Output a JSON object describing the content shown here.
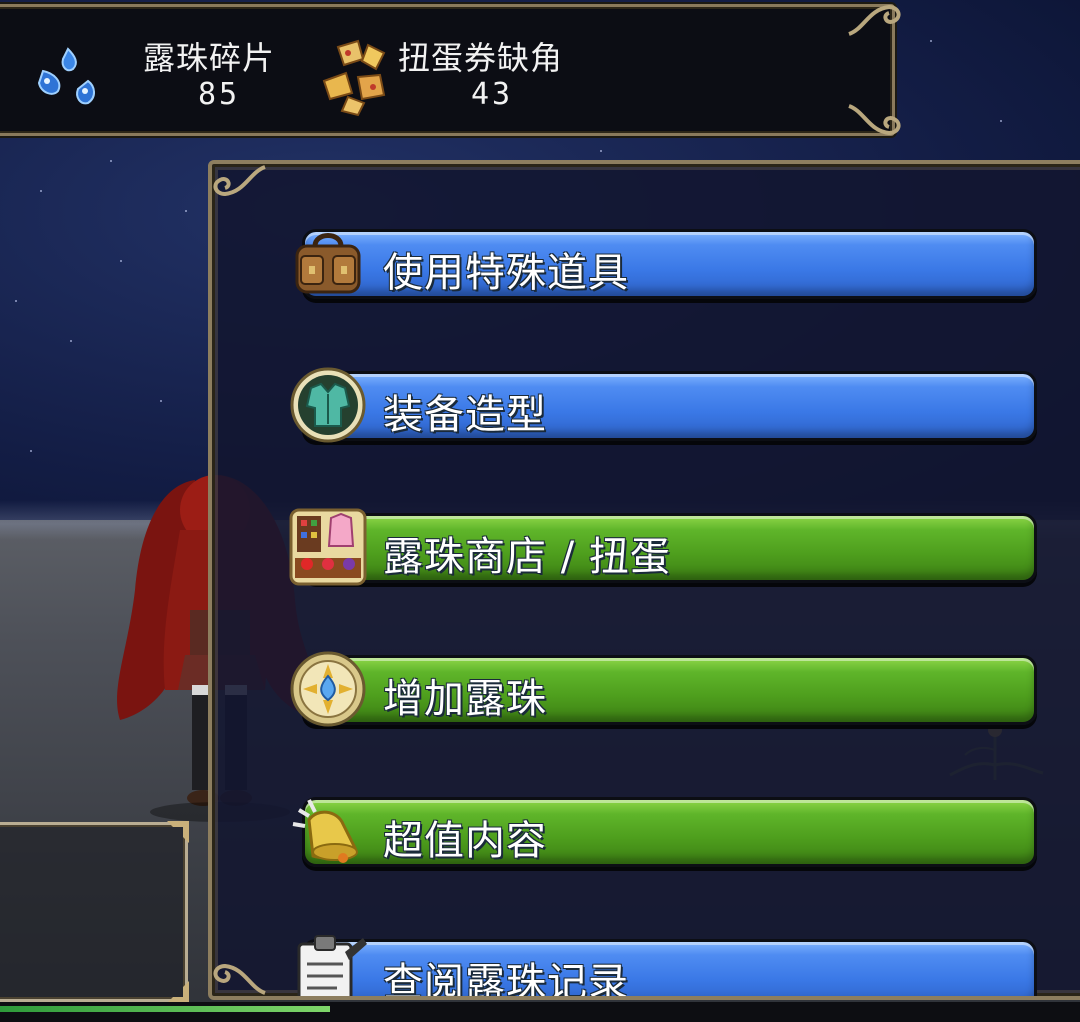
{
  "currencies": [
    {
      "name": "露珠碎片",
      "value": "85",
      "icon": "dew-shard-icon"
    },
    {
      "name": "扭蛋券缺角",
      "value": "43",
      "icon": "gacha-ticket-fragment-icon"
    }
  ],
  "menu": {
    "items": [
      {
        "label": "使用特殊道具",
        "color": "blue",
        "icon": "bag-icon"
      },
      {
        "label": "装备造型",
        "color": "blue",
        "icon": "armor-icon"
      },
      {
        "label": "露珠商店 / 扭蛋",
        "color": "green",
        "icon": "shop-icon"
      },
      {
        "label": "增加露珠",
        "color": "green",
        "icon": "dew-orb-icon"
      },
      {
        "label": "超值内容",
        "color": "green",
        "icon": "bell-icon"
      },
      {
        "label": "查阅露珠记录",
        "color": "blue",
        "icon": "clipboard-icon"
      }
    ]
  },
  "colors": {
    "blue_button": "#3a78e6",
    "green_button": "#4e9e1d",
    "panel_border": "#8d7e5f"
  }
}
